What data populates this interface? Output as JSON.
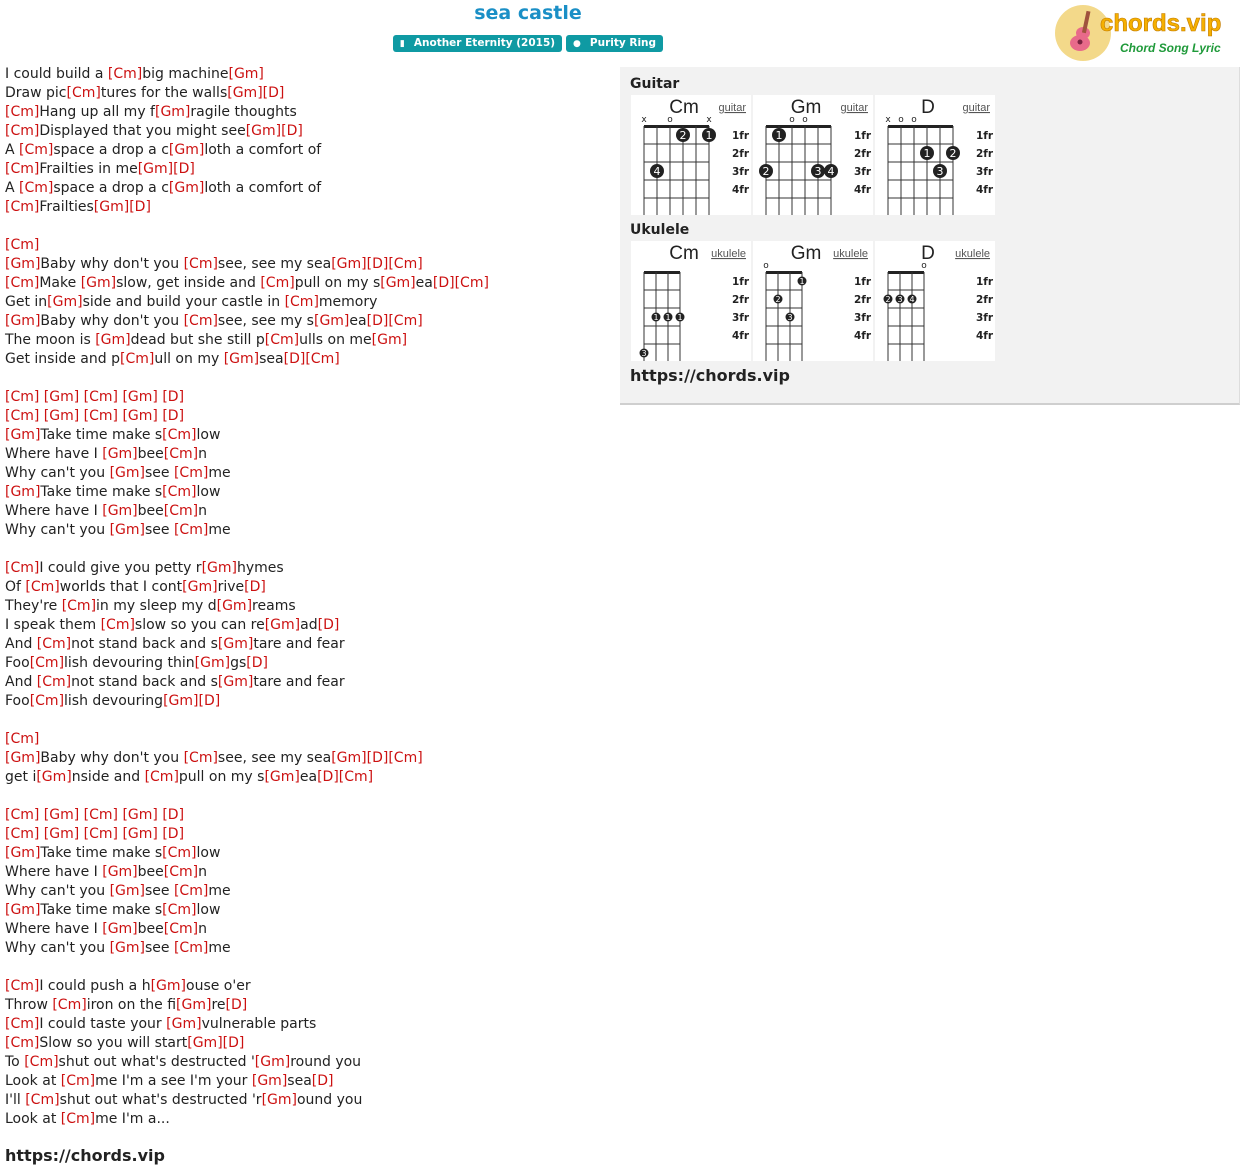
{
  "header": {
    "title": "sea castle",
    "album_tag": "Another Eternity (2015)",
    "artist_tag": "Purity Ring",
    "logo_text": "chords.vip",
    "logo_subtext": "Chord Song Lyric"
  },
  "lyrics": [
    [
      [
        "t",
        "I could build a "
      ],
      [
        "c",
        "[Cm]"
      ],
      [
        "t",
        "big machine"
      ],
      [
        "c",
        "[Gm]"
      ]
    ],
    [
      [
        "t",
        "Draw pic"
      ],
      [
        "c",
        "[Cm]"
      ],
      [
        "t",
        "tures for the walls"
      ],
      [
        "c",
        "[Gm]"
      ],
      [
        "c",
        "[D]"
      ]
    ],
    [
      [
        "c",
        "[Cm]"
      ],
      [
        "t",
        "Hang up all my f"
      ],
      [
        "c",
        "[Gm]"
      ],
      [
        "t",
        "ragile thoughts"
      ]
    ],
    [
      [
        "c",
        "[Cm]"
      ],
      [
        "t",
        "Displayed that you might see"
      ],
      [
        "c",
        "[Gm]"
      ],
      [
        "c",
        "[D]"
      ]
    ],
    [
      [
        "t",
        "A "
      ],
      [
        "c",
        "[Cm]"
      ],
      [
        "t",
        "space a drop a c"
      ],
      [
        "c",
        "[Gm]"
      ],
      [
        "t",
        "loth a comfort of"
      ]
    ],
    [
      [
        "c",
        "[Cm]"
      ],
      [
        "t",
        "Frailties in me"
      ],
      [
        "c",
        "[Gm]"
      ],
      [
        "c",
        "[D]"
      ]
    ],
    [
      [
        "t",
        "A "
      ],
      [
        "c",
        "[Cm]"
      ],
      [
        "t",
        "space a drop a c"
      ],
      [
        "c",
        "[Gm]"
      ],
      [
        "t",
        "loth a comfort of"
      ]
    ],
    [
      [
        "c",
        "[Cm]"
      ],
      [
        "t",
        "Frailties"
      ],
      [
        "c",
        "[Gm]"
      ],
      [
        "c",
        "[D]"
      ]
    ],
    [],
    [
      [
        "c",
        "[Cm]"
      ]
    ],
    [
      [
        "c",
        "[Gm]"
      ],
      [
        "t",
        "Baby why don't you "
      ],
      [
        "c",
        "[Cm]"
      ],
      [
        "t",
        "see, see my sea"
      ],
      [
        "c",
        "[Gm]"
      ],
      [
        "c",
        "[D]"
      ],
      [
        "c",
        "[Cm]"
      ]
    ],
    [
      [
        "c",
        "[Cm]"
      ],
      [
        "t",
        "Make "
      ],
      [
        "c",
        "[Gm]"
      ],
      [
        "t",
        "slow, get inside and "
      ],
      [
        "c",
        "[Cm]"
      ],
      [
        "t",
        "pull on my s"
      ],
      [
        "c",
        "[Gm]"
      ],
      [
        "t",
        "ea"
      ],
      [
        "c",
        "[D]"
      ],
      [
        "c",
        "[Cm]"
      ]
    ],
    [
      [
        "t",
        "Get in"
      ],
      [
        "c",
        "[Gm]"
      ],
      [
        "t",
        "side and build your castle in "
      ],
      [
        "c",
        "[Cm]"
      ],
      [
        "t",
        "memory"
      ]
    ],
    [
      [
        "c",
        "[Gm]"
      ],
      [
        "t",
        "Baby why don't you "
      ],
      [
        "c",
        "[Cm]"
      ],
      [
        "t",
        "see, see my s"
      ],
      [
        "c",
        "[Gm]"
      ],
      [
        "t",
        "ea"
      ],
      [
        "c",
        "[D]"
      ],
      [
        "c",
        "[Cm]"
      ]
    ],
    [
      [
        "t",
        "The moon is "
      ],
      [
        "c",
        "[Gm]"
      ],
      [
        "t",
        "dead but she still p"
      ],
      [
        "c",
        "[Cm]"
      ],
      [
        "t",
        "ulls on me"
      ],
      [
        "c",
        "[Gm]"
      ]
    ],
    [
      [
        "t",
        "Get inside and p"
      ],
      [
        "c",
        "[Cm]"
      ],
      [
        "t",
        "ull on my "
      ],
      [
        "c",
        "[Gm]"
      ],
      [
        "t",
        "sea"
      ],
      [
        "c",
        "[D]"
      ],
      [
        "c",
        "[Cm]"
      ]
    ],
    [],
    [
      [
        "c",
        "[Cm]"
      ],
      [
        "t",
        " "
      ],
      [
        "c",
        "[Gm]"
      ],
      [
        "t",
        " "
      ],
      [
        "c",
        "[Cm]"
      ],
      [
        "t",
        " "
      ],
      [
        "c",
        "[Gm]"
      ],
      [
        "t",
        " "
      ],
      [
        "c",
        "[D]"
      ]
    ],
    [
      [
        "c",
        "[Cm]"
      ],
      [
        "t",
        " "
      ],
      [
        "c",
        "[Gm]"
      ],
      [
        "t",
        " "
      ],
      [
        "c",
        "[Cm]"
      ],
      [
        "t",
        " "
      ],
      [
        "c",
        "[Gm]"
      ],
      [
        "t",
        " "
      ],
      [
        "c",
        "[D]"
      ]
    ],
    [
      [
        "c",
        "[Gm]"
      ],
      [
        "t",
        "Take time make s"
      ],
      [
        "c",
        "[Cm]"
      ],
      [
        "t",
        "low"
      ]
    ],
    [
      [
        "t",
        "Where have I "
      ],
      [
        "c",
        "[Gm]"
      ],
      [
        "t",
        "bee"
      ],
      [
        "c",
        "[Cm]"
      ],
      [
        "t",
        "n"
      ]
    ],
    [
      [
        "t",
        "Why can't you "
      ],
      [
        "c",
        "[Gm]"
      ],
      [
        "t",
        "see "
      ],
      [
        "c",
        "[Cm]"
      ],
      [
        "t",
        "me"
      ]
    ],
    [
      [
        "c",
        "[Gm]"
      ],
      [
        "t",
        "Take time make s"
      ],
      [
        "c",
        "[Cm]"
      ],
      [
        "t",
        "low"
      ]
    ],
    [
      [
        "t",
        "Where have I "
      ],
      [
        "c",
        "[Gm]"
      ],
      [
        "t",
        "bee"
      ],
      [
        "c",
        "[Cm]"
      ],
      [
        "t",
        "n"
      ]
    ],
    [
      [
        "t",
        "Why can't you "
      ],
      [
        "c",
        "[Gm]"
      ],
      [
        "t",
        "see "
      ],
      [
        "c",
        "[Cm]"
      ],
      [
        "t",
        "me"
      ]
    ],
    [],
    [
      [
        "c",
        "[Cm]"
      ],
      [
        "t",
        "I could give you petty r"
      ],
      [
        "c",
        "[Gm]"
      ],
      [
        "t",
        "hymes"
      ]
    ],
    [
      [
        "t",
        "Of "
      ],
      [
        "c",
        "[Cm]"
      ],
      [
        "t",
        "worlds that I cont"
      ],
      [
        "c",
        "[Gm]"
      ],
      [
        "t",
        "rive"
      ],
      [
        "c",
        "[D]"
      ]
    ],
    [
      [
        "t",
        "They're "
      ],
      [
        "c",
        "[Cm]"
      ],
      [
        "t",
        "in my sleep my d"
      ],
      [
        "c",
        "[Gm]"
      ],
      [
        "t",
        "reams"
      ]
    ],
    [
      [
        "t",
        "I speak them "
      ],
      [
        "c",
        "[Cm]"
      ],
      [
        "t",
        "slow so you can re"
      ],
      [
        "c",
        "[Gm]"
      ],
      [
        "t",
        "ad"
      ],
      [
        "c",
        "[D]"
      ]
    ],
    [
      [
        "t",
        "And "
      ],
      [
        "c",
        "[Cm]"
      ],
      [
        "t",
        "not stand back and s"
      ],
      [
        "c",
        "[Gm]"
      ],
      [
        "t",
        "tare and fear"
      ]
    ],
    [
      [
        "t",
        "Foo"
      ],
      [
        "c",
        "[Cm]"
      ],
      [
        "t",
        "lish devouring thin"
      ],
      [
        "c",
        "[Gm]"
      ],
      [
        "t",
        "gs"
      ],
      [
        "c",
        "[D]"
      ]
    ],
    [
      [
        "t",
        "And "
      ],
      [
        "c",
        "[Cm]"
      ],
      [
        "t",
        "not stand back and s"
      ],
      [
        "c",
        "[Gm]"
      ],
      [
        "t",
        "tare and fear"
      ]
    ],
    [
      [
        "t",
        "Foo"
      ],
      [
        "c",
        "[Cm]"
      ],
      [
        "t",
        "lish devouring"
      ],
      [
        "c",
        "[Gm]"
      ],
      [
        "c",
        "[D]"
      ]
    ],
    [],
    [
      [
        "c",
        "[Cm]"
      ]
    ],
    [
      [
        "c",
        "[Gm]"
      ],
      [
        "t",
        "Baby why don't you "
      ],
      [
        "c",
        "[Cm]"
      ],
      [
        "t",
        "see, see my sea"
      ],
      [
        "c",
        "[Gm]"
      ],
      [
        "c",
        "[D]"
      ],
      [
        "c",
        "[Cm]"
      ]
    ],
    [
      [
        "t",
        "get i"
      ],
      [
        "c",
        "[Gm]"
      ],
      [
        "t",
        "nside and "
      ],
      [
        "c",
        "[Cm]"
      ],
      [
        "t",
        "pull on my s"
      ],
      [
        "c",
        "[Gm]"
      ],
      [
        "t",
        "ea"
      ],
      [
        "c",
        "[D]"
      ],
      [
        "c",
        "[Cm]"
      ]
    ],
    [],
    [
      [
        "c",
        "[Cm]"
      ],
      [
        "t",
        " "
      ],
      [
        "c",
        "[Gm]"
      ],
      [
        "t",
        " "
      ],
      [
        "c",
        "[Cm]"
      ],
      [
        "t",
        " "
      ],
      [
        "c",
        "[Gm]"
      ],
      [
        "t",
        " "
      ],
      [
        "c",
        "[D]"
      ]
    ],
    [
      [
        "c",
        "[Cm]"
      ],
      [
        "t",
        " "
      ],
      [
        "c",
        "[Gm]"
      ],
      [
        "t",
        " "
      ],
      [
        "c",
        "[Cm]"
      ],
      [
        "t",
        " "
      ],
      [
        "c",
        "[Gm]"
      ],
      [
        "t",
        " "
      ],
      [
        "c",
        "[D]"
      ]
    ],
    [
      [
        "c",
        "[Gm]"
      ],
      [
        "t",
        "Take time make s"
      ],
      [
        "c",
        "[Cm]"
      ],
      [
        "t",
        "low"
      ]
    ],
    [
      [
        "t",
        "Where have I "
      ],
      [
        "c",
        "[Gm]"
      ],
      [
        "t",
        "bee"
      ],
      [
        "c",
        "[Cm]"
      ],
      [
        "t",
        "n"
      ]
    ],
    [
      [
        "t",
        "Why can't you "
      ],
      [
        "c",
        "[Gm]"
      ],
      [
        "t",
        "see "
      ],
      [
        "c",
        "[Cm]"
      ],
      [
        "t",
        "me"
      ]
    ],
    [
      [
        "c",
        "[Gm]"
      ],
      [
        "t",
        "Take time make s"
      ],
      [
        "c",
        "[Cm]"
      ],
      [
        "t",
        "low"
      ]
    ],
    [
      [
        "t",
        "Where have I "
      ],
      [
        "c",
        "[Gm]"
      ],
      [
        "t",
        "bee"
      ],
      [
        "c",
        "[Cm]"
      ],
      [
        "t",
        "n"
      ]
    ],
    [
      [
        "t",
        "Why can't you "
      ],
      [
        "c",
        "[Gm]"
      ],
      [
        "t",
        "see "
      ],
      [
        "c",
        "[Cm]"
      ],
      [
        "t",
        "me"
      ]
    ],
    [],
    [
      [
        "c",
        "[Cm]"
      ],
      [
        "t",
        "I could push a h"
      ],
      [
        "c",
        "[Gm]"
      ],
      [
        "t",
        "ouse o'er"
      ]
    ],
    [
      [
        "t",
        "Throw "
      ],
      [
        "c",
        "[Cm]"
      ],
      [
        "t",
        "iron on the fi"
      ],
      [
        "c",
        "[Gm]"
      ],
      [
        "t",
        "re"
      ],
      [
        "c",
        "[D]"
      ]
    ],
    [
      [
        "c",
        "[Cm]"
      ],
      [
        "t",
        "I could taste your "
      ],
      [
        "c",
        "[Gm]"
      ],
      [
        "t",
        "vulnerable parts"
      ]
    ],
    [
      [
        "c",
        "[Cm]"
      ],
      [
        "t",
        "Slow so you will start"
      ],
      [
        "c",
        "[Gm]"
      ],
      [
        "c",
        "[D]"
      ]
    ],
    [
      [
        "t",
        "To "
      ],
      [
        "c",
        "[Cm]"
      ],
      [
        "t",
        "shut out what's destructed '"
      ],
      [
        "c",
        "[Gm]"
      ],
      [
        "t",
        "round you"
      ]
    ],
    [
      [
        "t",
        "Look at "
      ],
      [
        "c",
        "[Cm]"
      ],
      [
        "t",
        "me I'm a see I'm your "
      ],
      [
        "c",
        "[Gm]"
      ],
      [
        "t",
        "sea"
      ],
      [
        "c",
        "[D]"
      ]
    ],
    [
      [
        "t",
        "I'll "
      ],
      [
        "c",
        "[Cm]"
      ],
      [
        "t",
        "shut out what's destructed 'r"
      ],
      [
        "c",
        "[Gm]"
      ],
      [
        "t",
        "ound you"
      ]
    ],
    [
      [
        "t",
        "Look at "
      ],
      [
        "c",
        "[Cm]"
      ],
      [
        "t",
        "me I'm a..."
      ]
    ]
  ],
  "footer_link": "https://chords.vip",
  "chords_panel": {
    "guitar_label": "Guitar",
    "ukulele_label": "Ukulele",
    "panel_link": "https://chords.vip",
    "fret_labels": [
      "1fr",
      "2fr",
      "3fr",
      "4fr"
    ],
    "guitar": [
      {
        "name": "Cm",
        "link": "guitar",
        "open": [
          "x",
          "",
          "o",
          "",
          "",
          "x"
        ],
        "dots": [
          [
            3,
            1,
            "2"
          ],
          [
            5,
            1,
            "1"
          ],
          [
            1,
            3,
            "4"
          ]
        ]
      },
      {
        "name": "Gm",
        "link": "guitar",
        "open": [
          "",
          "",
          "o",
          "o",
          "",
          ""
        ],
        "dots": [
          [
            1,
            1,
            "1"
          ],
          [
            0,
            3,
            "2"
          ],
          [
            4,
            3,
            "3"
          ],
          [
            5,
            3,
            "4"
          ]
        ]
      },
      {
        "name": "D",
        "link": "guitar",
        "open": [
          "x",
          "o",
          "o",
          "",
          "",
          ""
        ],
        "dots": [
          [
            3,
            2,
            "1"
          ],
          [
            5,
            2,
            "2"
          ],
          [
            4,
            3,
            "3"
          ]
        ]
      }
    ],
    "ukulele": [
      {
        "name": "Cm",
        "link": "ukulele",
        "open": [
          "",
          "",
          "",
          ""
        ],
        "dots": [
          [
            1,
            3,
            "1"
          ],
          [
            2,
            3,
            "1"
          ],
          [
            3,
            3,
            "1"
          ],
          [
            0,
            5,
            "3"
          ]
        ]
      },
      {
        "name": "Gm",
        "link": "ukulele",
        "open": [
          "o",
          "",
          "",
          ""
        ],
        "dots": [
          [
            3,
            1,
            "1"
          ],
          [
            1,
            2,
            "2"
          ],
          [
            2,
            3,
            "3"
          ]
        ]
      },
      {
        "name": "D",
        "link": "ukulele",
        "open": [
          "",
          "",
          "",
          "o"
        ],
        "dots": [
          [
            0,
            2,
            "2"
          ],
          [
            1,
            2,
            "3"
          ],
          [
            2,
            2,
            "4"
          ]
        ]
      }
    ]
  }
}
